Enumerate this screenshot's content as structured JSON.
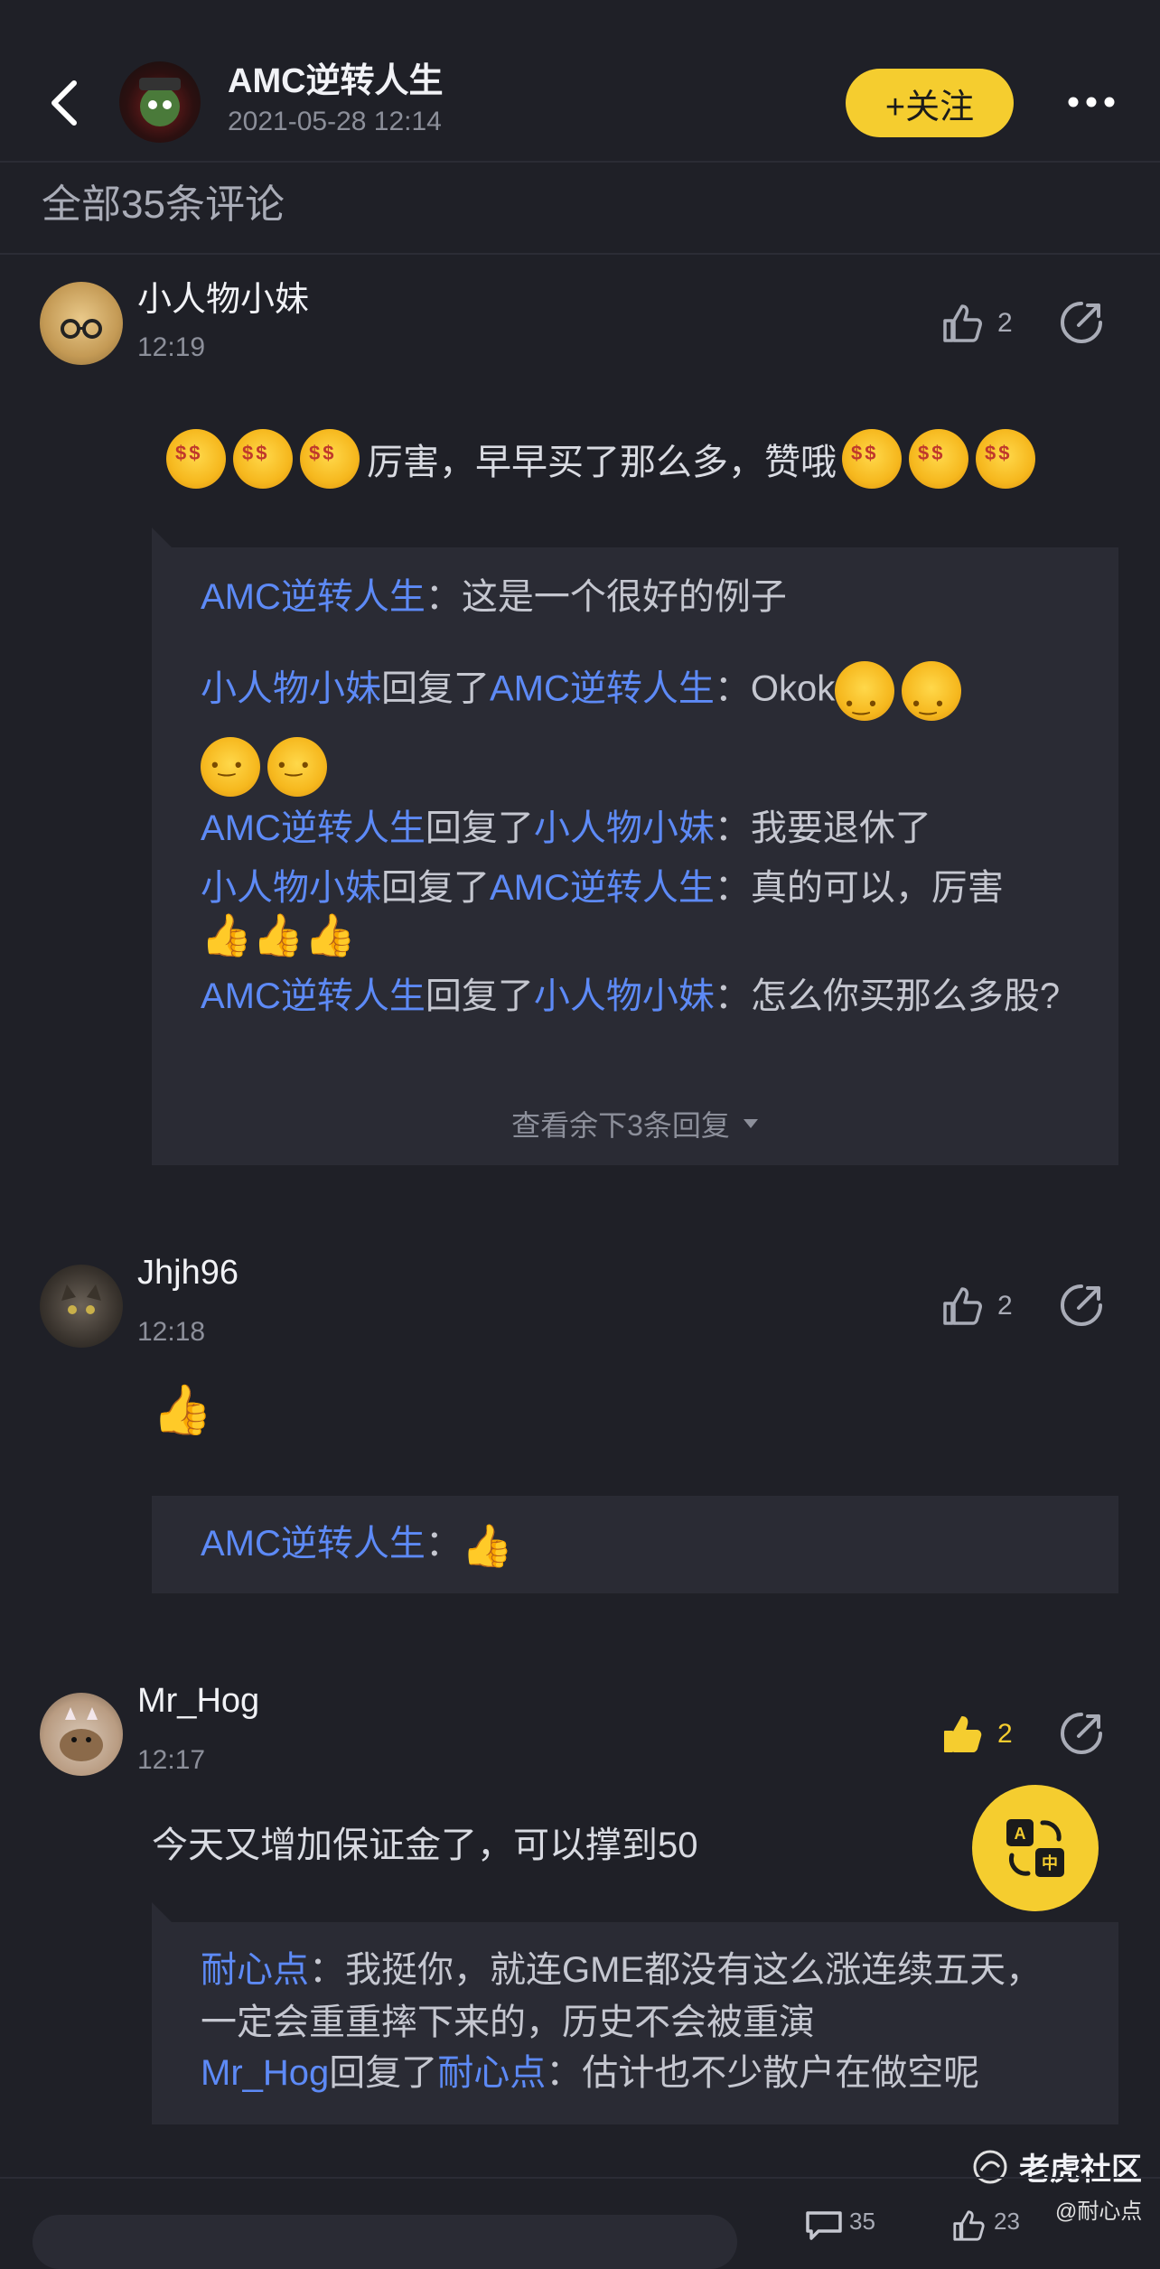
{
  "header": {
    "author_name": "AMC逆转人生",
    "post_time": "2021-05-28 12:14",
    "follow_label": "+关注",
    "more_label": "•••"
  },
  "comments_count_label": "全部35条评论",
  "comments": [
    {
      "username": "小人物小妹",
      "time": "12:19",
      "likes": "2",
      "text": "厉害，早早买了那么多，赞哦",
      "replies": [
        {
          "from": "AMC逆转人生",
          "to": "",
          "text": "这是一个很好的例子"
        },
        {
          "from": "小人物小妹",
          "to": "AMC逆转人生",
          "text": "Okok"
        },
        {
          "from": "AMC逆转人生",
          "to": "小人物小妹",
          "text": "我要退休了"
        },
        {
          "from": "小人物小妹",
          "to": "AMC逆转人生",
          "text": "真的可以，厉害"
        },
        {
          "from": "AMC逆转人生",
          "to": "小人物小妹",
          "text": "怎么你买那么多股?"
        }
      ],
      "reply_word": "回复了",
      "more_replies": "查看余下3条回复"
    },
    {
      "username": "Jhjh96",
      "time": "12:18",
      "likes": "2",
      "replies": [
        {
          "from": "AMC逆转人生",
          "to": "",
          "text": ""
        }
      ]
    },
    {
      "username": "Mr_Hog",
      "time": "12:17",
      "likes": "2",
      "text": "今天又增加保证金了，可以撑到50",
      "replies": [
        {
          "from": "耐心点",
          "to": "",
          "text": "我挺你，就连GME都没有这么涨连续五天，一定会重重摔下来的，历史不会被重演"
        },
        {
          "from": "Mr_Hog",
          "to": "耐心点",
          "text": "估计也不少散户在做空呢"
        }
      ]
    }
  ],
  "translate_icon": "translate-icon",
  "watermark": {
    "brand": "老虎社区",
    "handle": "@耐心点"
  },
  "bottom_bar": {
    "comments": "35",
    "likes": "23"
  },
  "colors": {
    "accent": "#f5cd2f",
    "link": "#5d8af6",
    "background": "#1f2027"
  }
}
